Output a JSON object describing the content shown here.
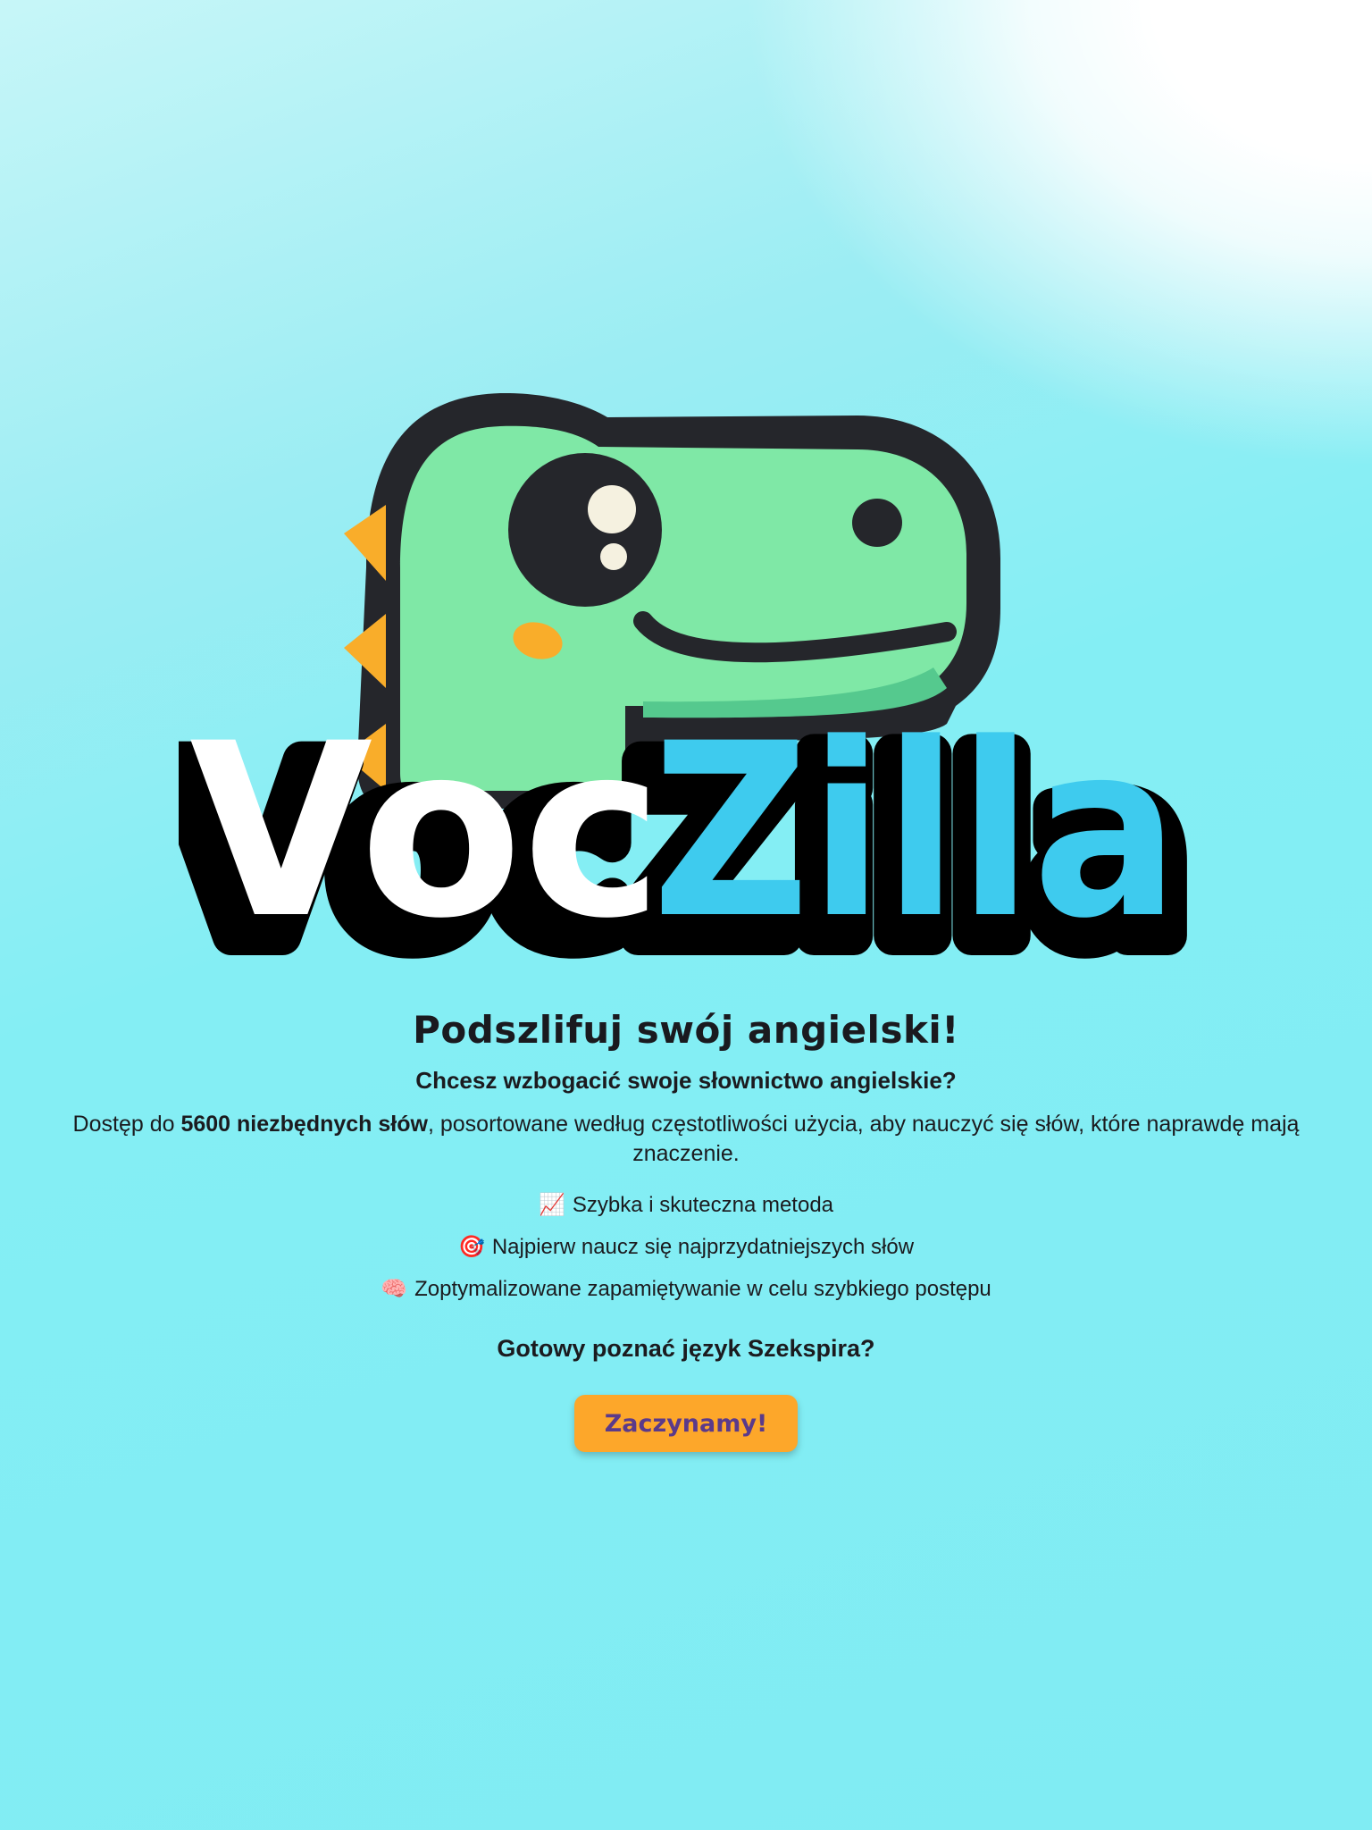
{
  "brand": {
    "logo_alt": "VocZilla",
    "part1": "Voc",
    "part2": "Zilla",
    "colors": {
      "dino_green": "#7fe8a6",
      "outline": "#25262b",
      "spikes": "#f9ad2a",
      "zilla_blue": "#3ecbee",
      "voc_white": "#ffffff"
    }
  },
  "hero": {
    "headline": "Podszlifuj swój angielski!",
    "question": "Chcesz wzbogacić swoje słownictwo angielskie?",
    "desc_pre": "Dostęp do ",
    "desc_bold": "5600 niezbędnych słów",
    "desc_post": ", posortowane według częstotliwości użycia, aby nauczyć się słów, które naprawdę mają znaczenie."
  },
  "features": [
    {
      "icon": "chart-increasing-icon",
      "emoji": "📈",
      "text": "Szybka i skuteczna metoda"
    },
    {
      "icon": "target-icon",
      "emoji": "🎯",
      "text": "Najpierw naucz się najprzydatniejszych słów"
    },
    {
      "icon": "brain-icon",
      "emoji": "🧠",
      "text": "Zoptymalizowane zapamiętywanie w celu szybkiego postępu"
    }
  ],
  "ready_text": "Gotowy poznać język Szekspira?",
  "cta": {
    "label": "Zaczynamy!",
    "color": "#fda72a",
    "text_color": "#5b3a8a"
  }
}
